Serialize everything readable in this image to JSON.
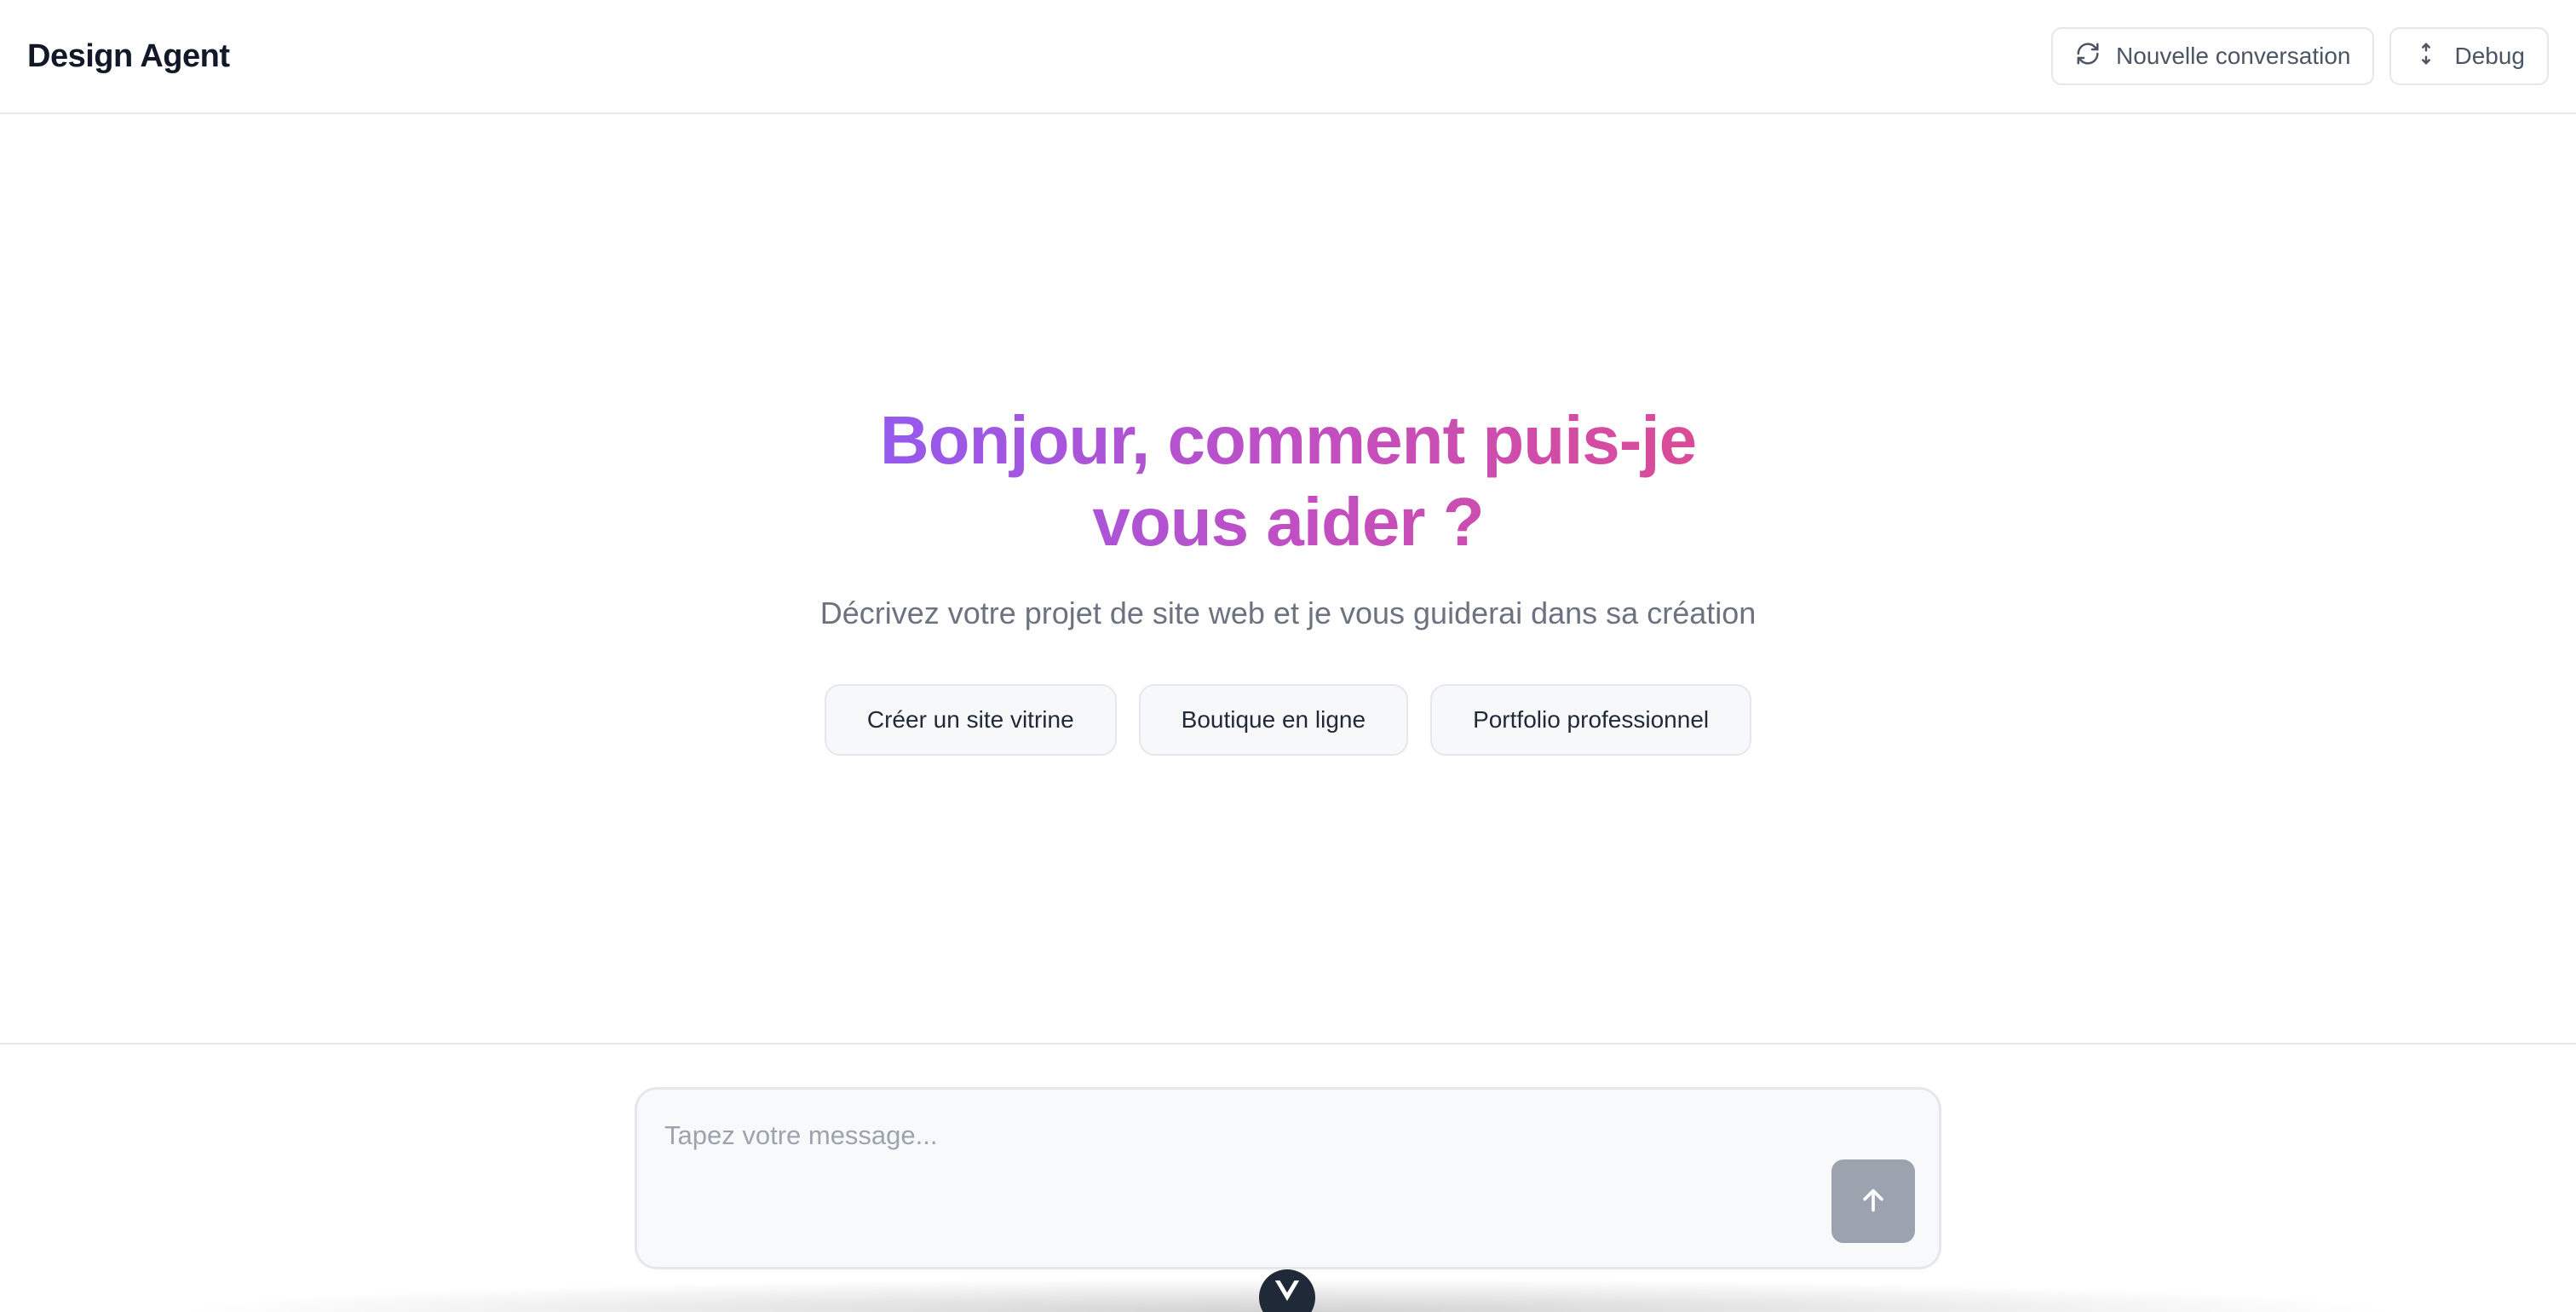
{
  "header": {
    "brand": "Design Agent",
    "new_conversation_label": "Nouvelle conversation",
    "new_conversation_icon": "refresh-icon",
    "debug_label": "Debug",
    "debug_icon": "debug-icon"
  },
  "hero": {
    "title": "Bonjour, comment puis-je vous aider ?",
    "subtitle": "Décrivez votre projet de site web et je vous guiderai dans sa création",
    "gradient_start": "#8b5cf6",
    "gradient_end": "#e04a8d",
    "suggestions": [
      "Créer un site vitrine",
      "Boutique en ligne",
      "Portfolio professionnel"
    ]
  },
  "composer": {
    "placeholder": "Tapez votre message...",
    "value": "",
    "send_icon": "arrow-up-icon",
    "send_color": "#9ca3af"
  },
  "devtools": {
    "icon": "vue-devtools-icon"
  }
}
